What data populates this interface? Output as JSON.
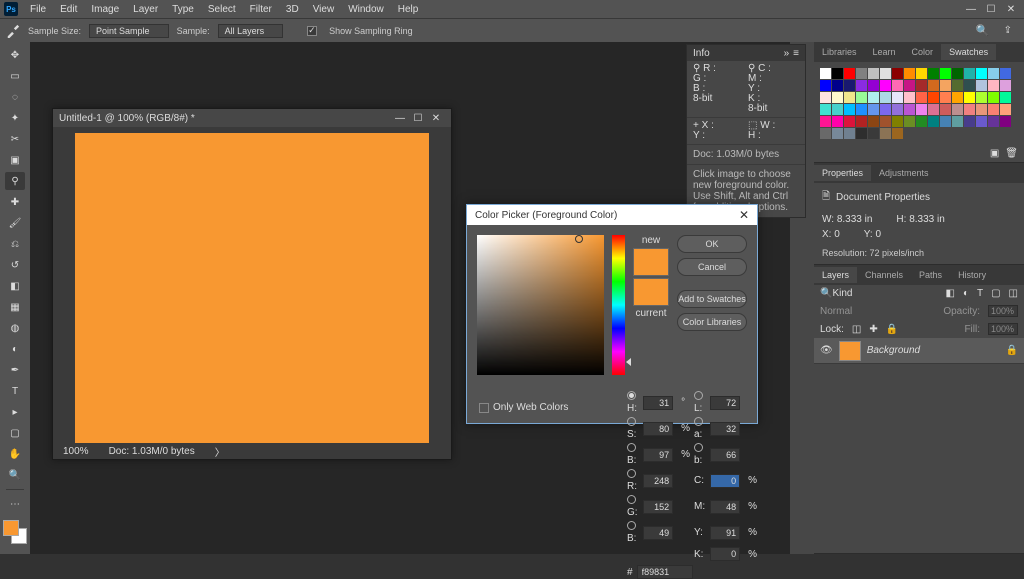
{
  "menu": {
    "items": [
      "File",
      "Edit",
      "Image",
      "Layer",
      "Type",
      "Select",
      "Filter",
      "3D",
      "View",
      "Window",
      "Help"
    ]
  },
  "optbar": {
    "sample_size_lbl": "Sample Size:",
    "sample_size": "Point Sample",
    "sample_lbl": "Sample:",
    "sample": "All Layers",
    "ring": "Show Sampling Ring"
  },
  "doc": {
    "title": "Untitled-1 @ 100% (RGB/8#) *",
    "zoom": "100%",
    "status": "Doc: 1.03M/0 bytes"
  },
  "info": {
    "title": "Info",
    "rgb": "R :\nG :\nB :\n8-bit",
    "cmyk": "C :\nM :\nY :\nK :\n8-bit",
    "xy": "X :\nY :",
    "wh": "W :\nH :",
    "doc": "Doc: 1.03M/0 bytes",
    "hint": "Click image to choose new foreground color. Use Shift, Alt and Ctrl for additional options."
  },
  "dialog": {
    "title": "Color Picker (Foreground Color)",
    "ok": "OK",
    "cancel": "Cancel",
    "add": "Add to Swatches",
    "libs": "Color Libraries",
    "new": "new",
    "current": "current",
    "H": "31",
    "S": "80",
    "Bv": "97",
    "L": "72",
    "a": "32",
    "b": "66",
    "R": "248",
    "G": "152",
    "Bb": "49",
    "C": "0",
    "M": "48",
    "Y": "91",
    "K": "0",
    "hex": "f89831",
    "webonly": "Only Web Colors"
  },
  "right": {
    "tabs1": [
      "Libraries",
      "Learn",
      "Color",
      "Swatches"
    ],
    "prop_tab": "Properties",
    "adj_tab": "Adjustments",
    "prop_title": "Document Properties",
    "w_lbl": "W:",
    "w": "8.333 in",
    "h_lbl": "H:",
    "h": "8.333 in",
    "x_lbl": "X:",
    "x": "0",
    "y_lbl": "Y:",
    "y": "0",
    "res": "Resolution: 72 pixels/inch",
    "layers_tabs": [
      "Layers",
      "Channels",
      "Paths",
      "History"
    ],
    "opacity_lbl": "Opacity:",
    "opacity": "100%",
    "fill_lbl": "Fill:",
    "fill": "100%",
    "blend": "Normal",
    "lock": "Lock:",
    "layer_name": "Background"
  },
  "colors": {
    "fg": "#f89831",
    "new": "#f89831",
    "current": "#f89831",
    "canvas": "#f89831",
    "swatches": [
      "#ffffff",
      "#000000",
      "#ff0000",
      "#808080",
      "#c0c0c0",
      "#e0e0e0",
      "#8b0000",
      "#ff8c00",
      "#ffd700",
      "#008000",
      "#00ff00",
      "#006400",
      "#20b2aa",
      "#00ffff",
      "#87ceeb",
      "#4169e1",
      "#0000ff",
      "#00008b",
      "#191970",
      "#8a2be2",
      "#9400d3",
      "#ff00ff",
      "#ff69b4",
      "#c71585",
      "#a52a2a",
      "#d2691e",
      "#f4a460",
      "#556b2f",
      "#2f4f4f",
      "#b0c4de",
      "#ffb6c1",
      "#dda0dd",
      "#ffe4e1",
      "#fffacd",
      "#f0e68c",
      "#98fb98",
      "#afeeee",
      "#add8e6",
      "#e6e6fa",
      "#ffc0cb",
      "#ff6347",
      "#ff4500",
      "#ff7f50",
      "#ffa500",
      "#ffff00",
      "#adff2f",
      "#7fff00",
      "#00fa9a",
      "#40e0d0",
      "#48d1cc",
      "#00bfff",
      "#1e90ff",
      "#6495ed",
      "#7b68ee",
      "#9370db",
      "#ba55d3",
      "#ee82ee",
      "#db7093",
      "#cd5c5c",
      "#bc8f8f",
      "#f08080",
      "#e9967a",
      "#fa8072",
      "#ffa07a",
      "#ff1493",
      "#ff00aa",
      "#dc143c",
      "#b22222",
      "#8b4513",
      "#a0522d",
      "#808000",
      "#6b8e23",
      "#228b22",
      "#008080",
      "#4682b4",
      "#5f9ea0",
      "#483d8b",
      "#6a5acd",
      "#663399",
      "#800080",
      "#696969",
      "#778899",
      "#708090",
      "#2e2e2e",
      "#3a3a3a",
      "#8b7355",
      "#9c661f"
    ]
  }
}
